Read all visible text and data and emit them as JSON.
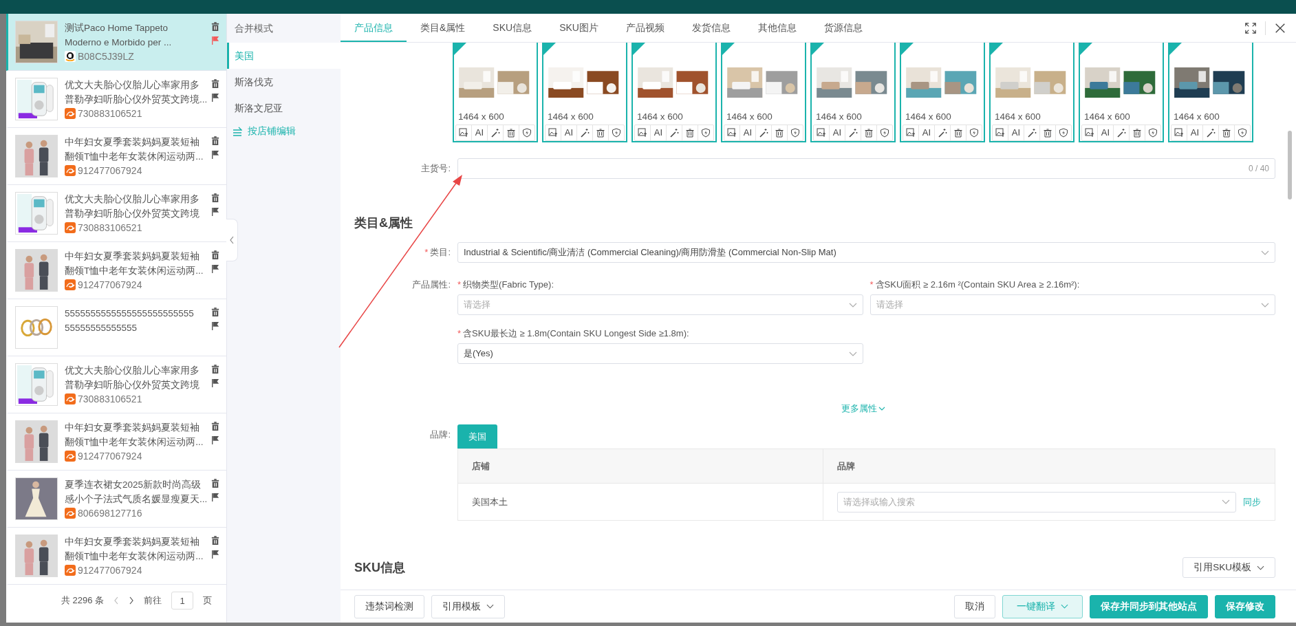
{
  "products": [
    {
      "title_lines": [
        "测试Paco Home Tappeto",
        "Moderno e Morbido per ..."
      ],
      "kind": "amazon",
      "code": "B08C5J39LZ",
      "selected": true,
      "flagged": true
    },
    {
      "title_lines": [
        "优文大夫胎心仪胎儿心率家用多",
        "普勒孕妇听胎心仪外贸英文跨境..."
      ],
      "kind": "alibaba",
      "code": "730883106521",
      "selected": false,
      "flagged": false
    },
    {
      "title_lines": [
        "中年妇女夏季套装妈妈夏装短袖",
        "翻领T恤中老年女装休闲运动两..."
      ],
      "kind": "alibaba",
      "code": "912477067924",
      "selected": false,
      "flagged": false
    },
    {
      "title_lines": [
        "优文大夫胎心仪胎儿心率家用多",
        "普勒孕妇听胎心仪外贸英文跨境"
      ],
      "kind": "alibaba",
      "code": "730883106521",
      "selected": false,
      "flagged": false
    },
    {
      "title_lines": [
        "中年妇女夏季套装妈妈夏装短袖",
        "翻领T恤中老年女装休闲运动两..."
      ],
      "kind": "alibaba",
      "code": "912477067924",
      "selected": false,
      "flagged": false
    },
    {
      "title_lines": [
        "5555555555555555555555555",
        "55555555555555"
      ],
      "selected": false,
      "flagged": false
    },
    {
      "title_lines": [
        "优文大夫胎心仪胎儿心率家用多",
        "普勒孕妇听胎心仪外贸英文跨境"
      ],
      "kind": "alibaba",
      "code": "730883106521",
      "selected": false,
      "flagged": false
    },
    {
      "title_lines": [
        "中年妇女夏季套装妈妈夏装短袖",
        "翻领T恤中老年女装休闲运动两..."
      ],
      "kind": "alibaba",
      "code": "912477067924",
      "selected": false,
      "flagged": false
    },
    {
      "title_lines": [
        "夏季连衣裙女2025新款时尚高级",
        "感小个子法式气质名媛显瘦夏天..."
      ],
      "kind": "alibaba",
      "code": "806698127716",
      "selected": false,
      "flagged": false
    },
    {
      "title_lines": [
        "中年妇女夏季套装妈妈夏装短袖",
        "翻领T恤中老年女装休闲运动两..."
      ],
      "kind": "alibaba",
      "code": "912477067924",
      "selected": false,
      "flagged": false
    }
  ],
  "pagination": {
    "total": "共 2296 条",
    "goto": "前往",
    "page": "1",
    "unit": "页"
  },
  "sites": {
    "mode": "合并模式",
    "items": [
      {
        "label": "美国",
        "selected": true
      },
      {
        "label": "斯洛伐克",
        "selected": false
      },
      {
        "label": "斯洛文尼亚",
        "selected": false
      }
    ],
    "edit_by_store": "按店铺编辑"
  },
  "tabs": [
    {
      "label": "产品信息",
      "selected": true
    },
    {
      "label": "类目&属性",
      "selected": false
    },
    {
      "label": "SKU信息",
      "selected": false
    },
    {
      "label": "SKU图片",
      "selected": false
    },
    {
      "label": "产品视频",
      "selected": false
    },
    {
      "label": "发货信息",
      "selected": false
    },
    {
      "label": "其他信息",
      "selected": false
    },
    {
      "label": "货源信息",
      "selected": false
    }
  ],
  "images": [
    {
      "size": "1464 x 600",
      "ai": "AI"
    },
    {
      "size": "1464 x 600",
      "ai": "AI"
    },
    {
      "size": "1464 x 600",
      "ai": "AI"
    },
    {
      "size": "1464 x 600",
      "ai": "AI"
    },
    {
      "size": "1464 x 600",
      "ai": "AI"
    },
    {
      "size": "1464 x 600",
      "ai": "AI"
    },
    {
      "size": "1464 x 600",
      "ai": "AI"
    },
    {
      "size": "1464 x 600",
      "ai": "AI"
    },
    {
      "size": "1464 x 600",
      "ai": "AI"
    }
  ],
  "main_sku": {
    "label": "主货号:",
    "counter": "0 / 40"
  },
  "category_section": {
    "heading": "类目&属性",
    "category_required_mark": "*",
    "category_label": "类目:",
    "category_value": "Industrial & Scientific/商业清洁 (Commercial Cleaning)/商用防滑垫 (Commercial Non-Slip Mat)",
    "attributes_label": "产品属性:",
    "attributes": [
      {
        "required_mark": "*",
        "label": "织物类型(Fabric Type):",
        "placeholder": "请选择"
      },
      {
        "required_mark": "*",
        "label": "含SKU面积 ≥ 2.16m ²(Contain SKU Area ≥ 2.16m²):",
        "placeholder": "请选择"
      },
      {
        "required_mark": "*",
        "label": "含SKU最长边 ≥ 1.8m(Contain SKU Longest Side ≥1.8m):",
        "value": "是(Yes)"
      }
    ],
    "more": "更多属性"
  },
  "brand": {
    "label": "品牌:",
    "tab": "美国",
    "columns": [
      "店铺",
      "品牌"
    ],
    "rows": [
      {
        "store": "美国本土",
        "placeholder": "请选择或输入搜索",
        "action": "同步"
      }
    ]
  },
  "sku_section": {
    "heading": "SKU信息",
    "template_button": "引用SKU模板"
  },
  "footer": {
    "left": [
      {
        "label": "违禁词检测",
        "kind": "default",
        "caret": false
      },
      {
        "label": "引用模板",
        "kind": "default",
        "caret": true
      }
    ],
    "right": [
      {
        "label": "取消",
        "kind": "default",
        "caret": false
      },
      {
        "label": "一键翻译",
        "kind": "light",
        "caret": true
      },
      {
        "label": "保存并同步到其他站点",
        "kind": "primary",
        "caret": false
      },
      {
        "label": "保存修改",
        "kind": "primary",
        "caret": false
      }
    ]
  }
}
